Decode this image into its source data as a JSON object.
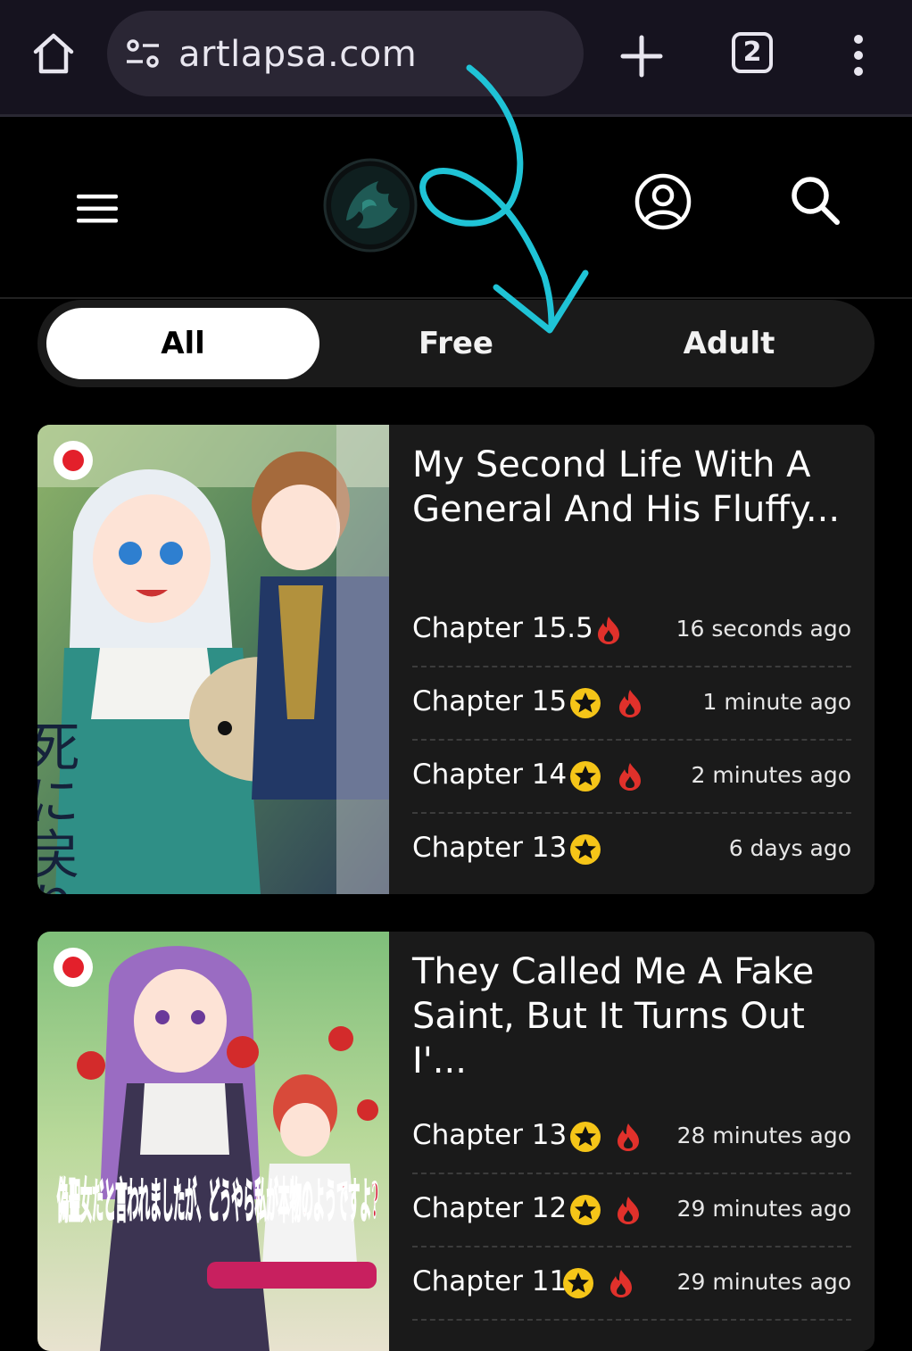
{
  "browser": {
    "url": "artlapsa.com",
    "tab_count": "2",
    "icons": [
      "home-icon",
      "site-settings-icon",
      "new-tab-icon",
      "tab-switcher-icon",
      "more-options-icon"
    ]
  },
  "header": {
    "icons": [
      "hamburger-menu-icon",
      "site-logo",
      "profile-icon",
      "search-icon"
    ]
  },
  "filters": {
    "items": [
      "All",
      "Free",
      "Adult"
    ],
    "active": "All"
  },
  "colors": {
    "accent_arrow": "#1fc3d6",
    "star_badge": "#f5c518",
    "hot_flame": "#e0312b",
    "card_bg": "#1a1a1a"
  },
  "manga": [
    {
      "title": "My Second Life With A General And His Fluffy...",
      "cover_label": "死に戻り令嬢の仮初め結婚",
      "chapters": [
        {
          "label": "Chapter 15.5",
          "time": "16 seconds ago",
          "star": false,
          "hot": true
        },
        {
          "label": "Chapter 15",
          "time": "1 minute ago",
          "star": true,
          "hot": true
        },
        {
          "label": "Chapter 14",
          "time": "2 minutes ago",
          "star": true,
          "hot": true
        },
        {
          "label": "Chapter 13",
          "time": "6 days ago",
          "star": true,
          "hot": false
        }
      ]
    },
    {
      "title": "They Called Me A Fake Saint, But It Turns Out I'...",
      "cover_label": "偽聖女だと言われましたが、どうやら私が本物のようですよ?",
      "chapters": [
        {
          "label": "Chapter 13",
          "time": "28 minutes ago",
          "star": true,
          "hot": true
        },
        {
          "label": "Chapter 12",
          "time": "29 minutes ago",
          "star": true,
          "hot": true
        },
        {
          "label": "Chapter 11",
          "time": "29 minutes ago",
          "star": true,
          "hot": true
        }
      ]
    }
  ]
}
